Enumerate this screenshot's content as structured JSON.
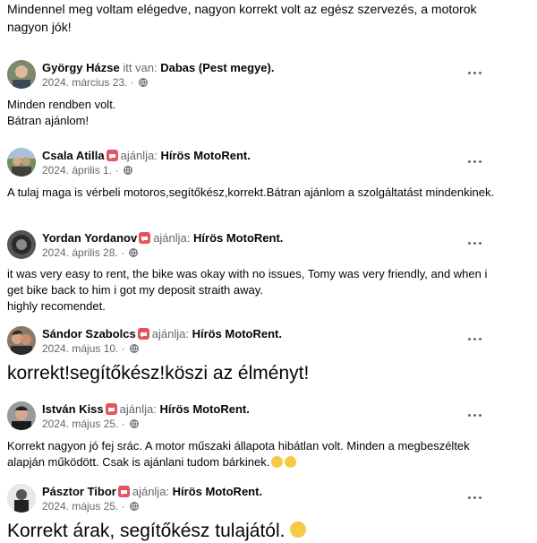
{
  "top_text": "Mindennel meg voltam elégedve, nagyon korrekt volt az egész szervezés, a motorok nagyon jók!",
  "posts": [
    {
      "name": "György Házse",
      "connector": "itt van:",
      "target": "Dabas (Pest megye)",
      "date": "2024. március 23.",
      "lines": [
        "Minden rendben volt.",
        "Bátran ajánlom!"
      ]
    },
    {
      "name": "Csala Atilla",
      "connector": "ajánlja:",
      "target": "Hírös MotoRent",
      "date": "2024. április 1.",
      "lines": [
        "A tulaj maga is vérbeli motoros,segítőkész,korrekt.Bátran ajánlom a szolgáltatást mindenkinek."
      ]
    },
    {
      "name": "Yordan Yordanov",
      "connector": "ajánlja:",
      "target": "Hírös MotoRent",
      "date": "2024. április 28.",
      "lines": [
        "it was very easy to rent, the bike was okay with no issues, Tomy was very friendly,  and when i",
        "get bike back to him i got my deposit straith away.",
        "highly recomendet."
      ]
    },
    {
      "name": "Sándor Szabolcs",
      "connector": "ajánlja:",
      "target": "Hírös MotoRent",
      "date": "2024. május 10.",
      "lines": [
        "korrekt!segítőkész!köszi az élményt!"
      ]
    },
    {
      "name": "István Kiss",
      "connector": "ajánlja:",
      "target": "Hírös MotoRent",
      "date": "2024. május 25.",
      "lines": [
        "Korrekt nagyon jó fej srác. A motor műszaki állapota hibátlan volt. Minden a megbeszéltek",
        "alapján működött. Csak is ajánlani tudom bárkinek."
      ]
    },
    {
      "name": "Pásztor Tibor",
      "connector": "ajánlja:",
      "target": "Hírös MotoRent",
      "date": "2024. május 25.",
      "lines": [
        "Korrekt árak, segítőkész tulajától."
      ]
    }
  ],
  "date_separator": "·",
  "icons": {
    "privacy": "globe-icon",
    "recommend": "recommend-badge-icon",
    "more": "more-options-icon",
    "emoji": "smiley-emoji-icon"
  },
  "colors": {
    "badge": "#e4545e",
    "muted": "#65676b",
    "text": "#050505"
  }
}
